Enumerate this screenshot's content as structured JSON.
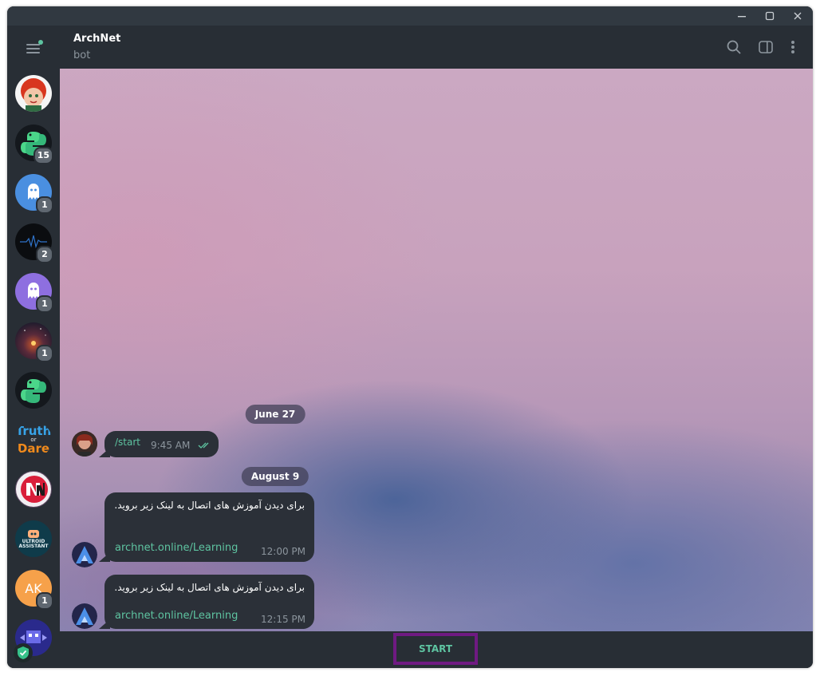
{
  "window_controls": {
    "minimize": "minimize-icon",
    "maximize": "maximize-icon",
    "close": "close-icon"
  },
  "header": {
    "chat_name": "ArchNet",
    "chat_status": "bot"
  },
  "sidebar": {
    "chats": [
      {
        "name": "chat-red-hair-girl",
        "badge": ""
      },
      {
        "name": "chat-python",
        "badge": "15"
      },
      {
        "name": "chat-ghost-blue",
        "badge": "1"
      },
      {
        "name": "chat-dark-wave",
        "badge": "2"
      },
      {
        "name": "chat-ghost-purple",
        "badge": "1"
      },
      {
        "name": "chat-campfire",
        "badge": "1"
      },
      {
        "name": "chat-python-2",
        "badge": ""
      },
      {
        "name": "chat-truth-or-dare",
        "badge": "",
        "logo_text": [
          "Truth",
          "or",
          "Dare"
        ]
      },
      {
        "name": "chat-nn-logo",
        "badge": ""
      },
      {
        "name": "chat-ultroid-assistant",
        "badge": "",
        "logo_text": [
          "ULTROID",
          "ASSISTANT"
        ]
      },
      {
        "name": "chat-ak",
        "badge": "1",
        "initials": "AK"
      },
      {
        "name": "chat-pixel-bot",
        "badge": ""
      }
    ]
  },
  "messages": {
    "date1": "June 27",
    "outgoing_text": "/start",
    "outgoing_time": "9:45 AM",
    "date2": "August 9",
    "bot1_text": "برای دیدن آموزش های اتصال به لینک زیر بروید.",
    "bot1_link": "archnet.online/Learning",
    "bot1_time": "12:00 PM",
    "bot2_text": "برای دیدن آموزش های اتصال به لینک زیر بروید.",
    "bot2_link": "archnet.online/Learning",
    "bot2_time": "12:15 PM"
  },
  "bottom": {
    "start_label": "START"
  },
  "colors": {
    "accent": "#5ec4a1",
    "panel": "#282e35",
    "bubble": "#2b3038",
    "highlight_border": "#6f1a82"
  }
}
